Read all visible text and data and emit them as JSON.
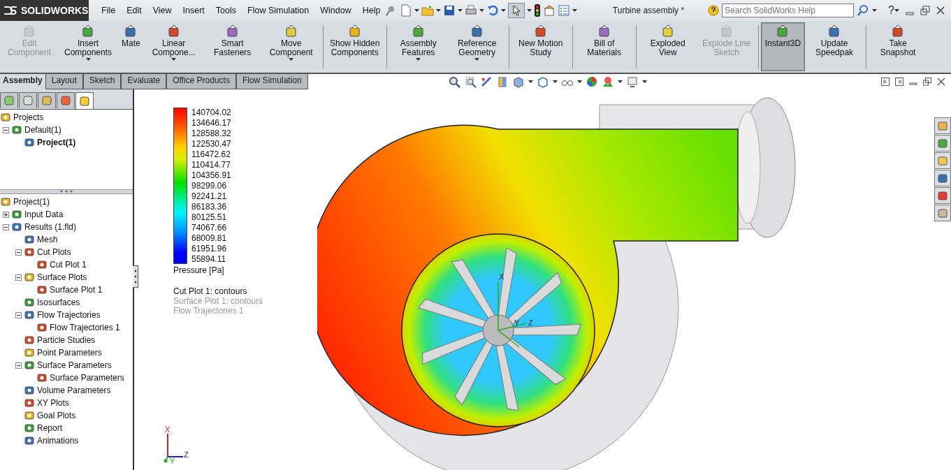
{
  "titlebar": {
    "logo": "SOLIDWORKS",
    "menus": [
      "File",
      "Edit",
      "View",
      "Insert",
      "Tools",
      "Flow Simulation",
      "Window",
      "Help"
    ],
    "document_title": "Turbine assembly *",
    "search": {
      "placeholder": "Search SolidWorks Help"
    },
    "help_glyph": "?"
  },
  "ribbon": {
    "groups": [
      [
        {
          "label": "Edit Component",
          "dropdown": false,
          "disabled": true,
          "selected": false
        },
        {
          "label": "Insert Components",
          "dropdown": true,
          "disabled": false,
          "selected": false
        },
        {
          "label": "Mate",
          "dropdown": false,
          "disabled": false,
          "selected": false
        },
        {
          "label": "Linear Compone...",
          "dropdown": true,
          "disabled": false,
          "selected": false
        },
        {
          "label": "Smart Fasteners",
          "dropdown": false,
          "disabled": false,
          "selected": false
        },
        {
          "label": "Move Component",
          "dropdown": true,
          "disabled": false,
          "selected": false
        }
      ],
      [
        {
          "label": "Show Hidden Components",
          "dropdown": false,
          "disabled": false,
          "selected": false
        }
      ],
      [
        {
          "label": "Assembly Features",
          "dropdown": true,
          "disabled": false,
          "selected": false
        },
        {
          "label": "Reference Geometry",
          "dropdown": true,
          "disabled": false,
          "selected": false
        }
      ],
      [
        {
          "label": "New Motion Study",
          "dropdown": false,
          "disabled": false,
          "selected": false
        }
      ],
      [
        {
          "label": "Bill of Materials",
          "dropdown": false,
          "disabled": false,
          "selected": false
        }
      ],
      [
        {
          "label": "Exploded View",
          "dropdown": false,
          "disabled": false,
          "selected": false
        },
        {
          "label": "Explode Line Sketch",
          "dropdown": false,
          "disabled": true,
          "selected": false
        }
      ],
      [
        {
          "label": "Instant3D",
          "dropdown": false,
          "disabled": false,
          "selected": true
        },
        {
          "label": "Update Speedpak",
          "dropdown": false,
          "disabled": false,
          "selected": false
        }
      ],
      [
        {
          "label": "Take Snapshot",
          "dropdown": false,
          "disabled": false,
          "selected": false
        }
      ]
    ]
  },
  "tabs": [
    {
      "label": "Assembly",
      "selected": true
    },
    {
      "label": "Layout",
      "selected": false
    },
    {
      "label": "Sketch",
      "selected": false
    },
    {
      "label": "Evaluate",
      "selected": false
    },
    {
      "label": "Office Products",
      "selected": false
    },
    {
      "label": "Flow Simulation",
      "selected": false
    }
  ],
  "panel_tabs": [
    {
      "selected": false
    },
    {
      "selected": false
    },
    {
      "selected": false
    },
    {
      "selected": false
    },
    {
      "selected": true
    }
  ],
  "projects_tree": [
    {
      "label": "Projects",
      "children": [
        {
          "label": "Default(1)",
          "expanded": true,
          "children": [
            {
              "label": "Project(1)",
              "active": true
            }
          ]
        }
      ]
    }
  ],
  "results_tree": [
    {
      "label": "Project(1)",
      "children": [
        {
          "label": "Input Data",
          "expanded": false
        },
        {
          "label": "Results (1.fld)",
          "expanded": true,
          "children": [
            {
              "label": "Mesh"
            },
            {
              "label": "Cut Plots",
              "expanded": true,
              "children": [
                {
                  "label": "Cut Plot 1"
                }
              ]
            },
            {
              "label": "Surface Plots",
              "expanded": true,
              "children": [
                {
                  "label": "Surface Plot 1"
                }
              ]
            },
            {
              "label": "Isosurfaces"
            },
            {
              "label": "Flow Trajectories",
              "expanded": true,
              "children": [
                {
                  "label": "Flow Trajectories 1"
                }
              ]
            },
            {
              "label": "Particle Studies"
            },
            {
              "label": "Point Parameters"
            },
            {
              "label": "Surface Parameters",
              "expanded": true,
              "children": [
                {
                  "label": "Surface Parameters"
                }
              ]
            },
            {
              "label": "Volume Parameters"
            },
            {
              "label": "XY Plots"
            },
            {
              "label": "Goal Plots"
            },
            {
              "label": "Report"
            },
            {
              "label": "Animations"
            }
          ]
        }
      ]
    }
  ],
  "legend": {
    "values": [
      "140704.02",
      "134646.17",
      "128588.32",
      "122530.47",
      "116472.62",
      "110414.77",
      "104356.91",
      "98299.06",
      "92241.21",
      "86183.36",
      "80125.51",
      "74067.66",
      "68009.81",
      "61951.96",
      "55894.11"
    ],
    "title": "Pressure [Pa]"
  },
  "plots": [
    {
      "label": "Cut Plot 1: contours",
      "active": true
    },
    {
      "label": "Surface Plot 1: contours",
      "active": false
    },
    {
      "label": "Flow Trajectories 1",
      "active": false
    }
  ],
  "model_triad": [
    "X",
    "Z",
    "Y"
  ],
  "orientation_triad": [
    "X",
    "Z",
    "Y"
  ]
}
